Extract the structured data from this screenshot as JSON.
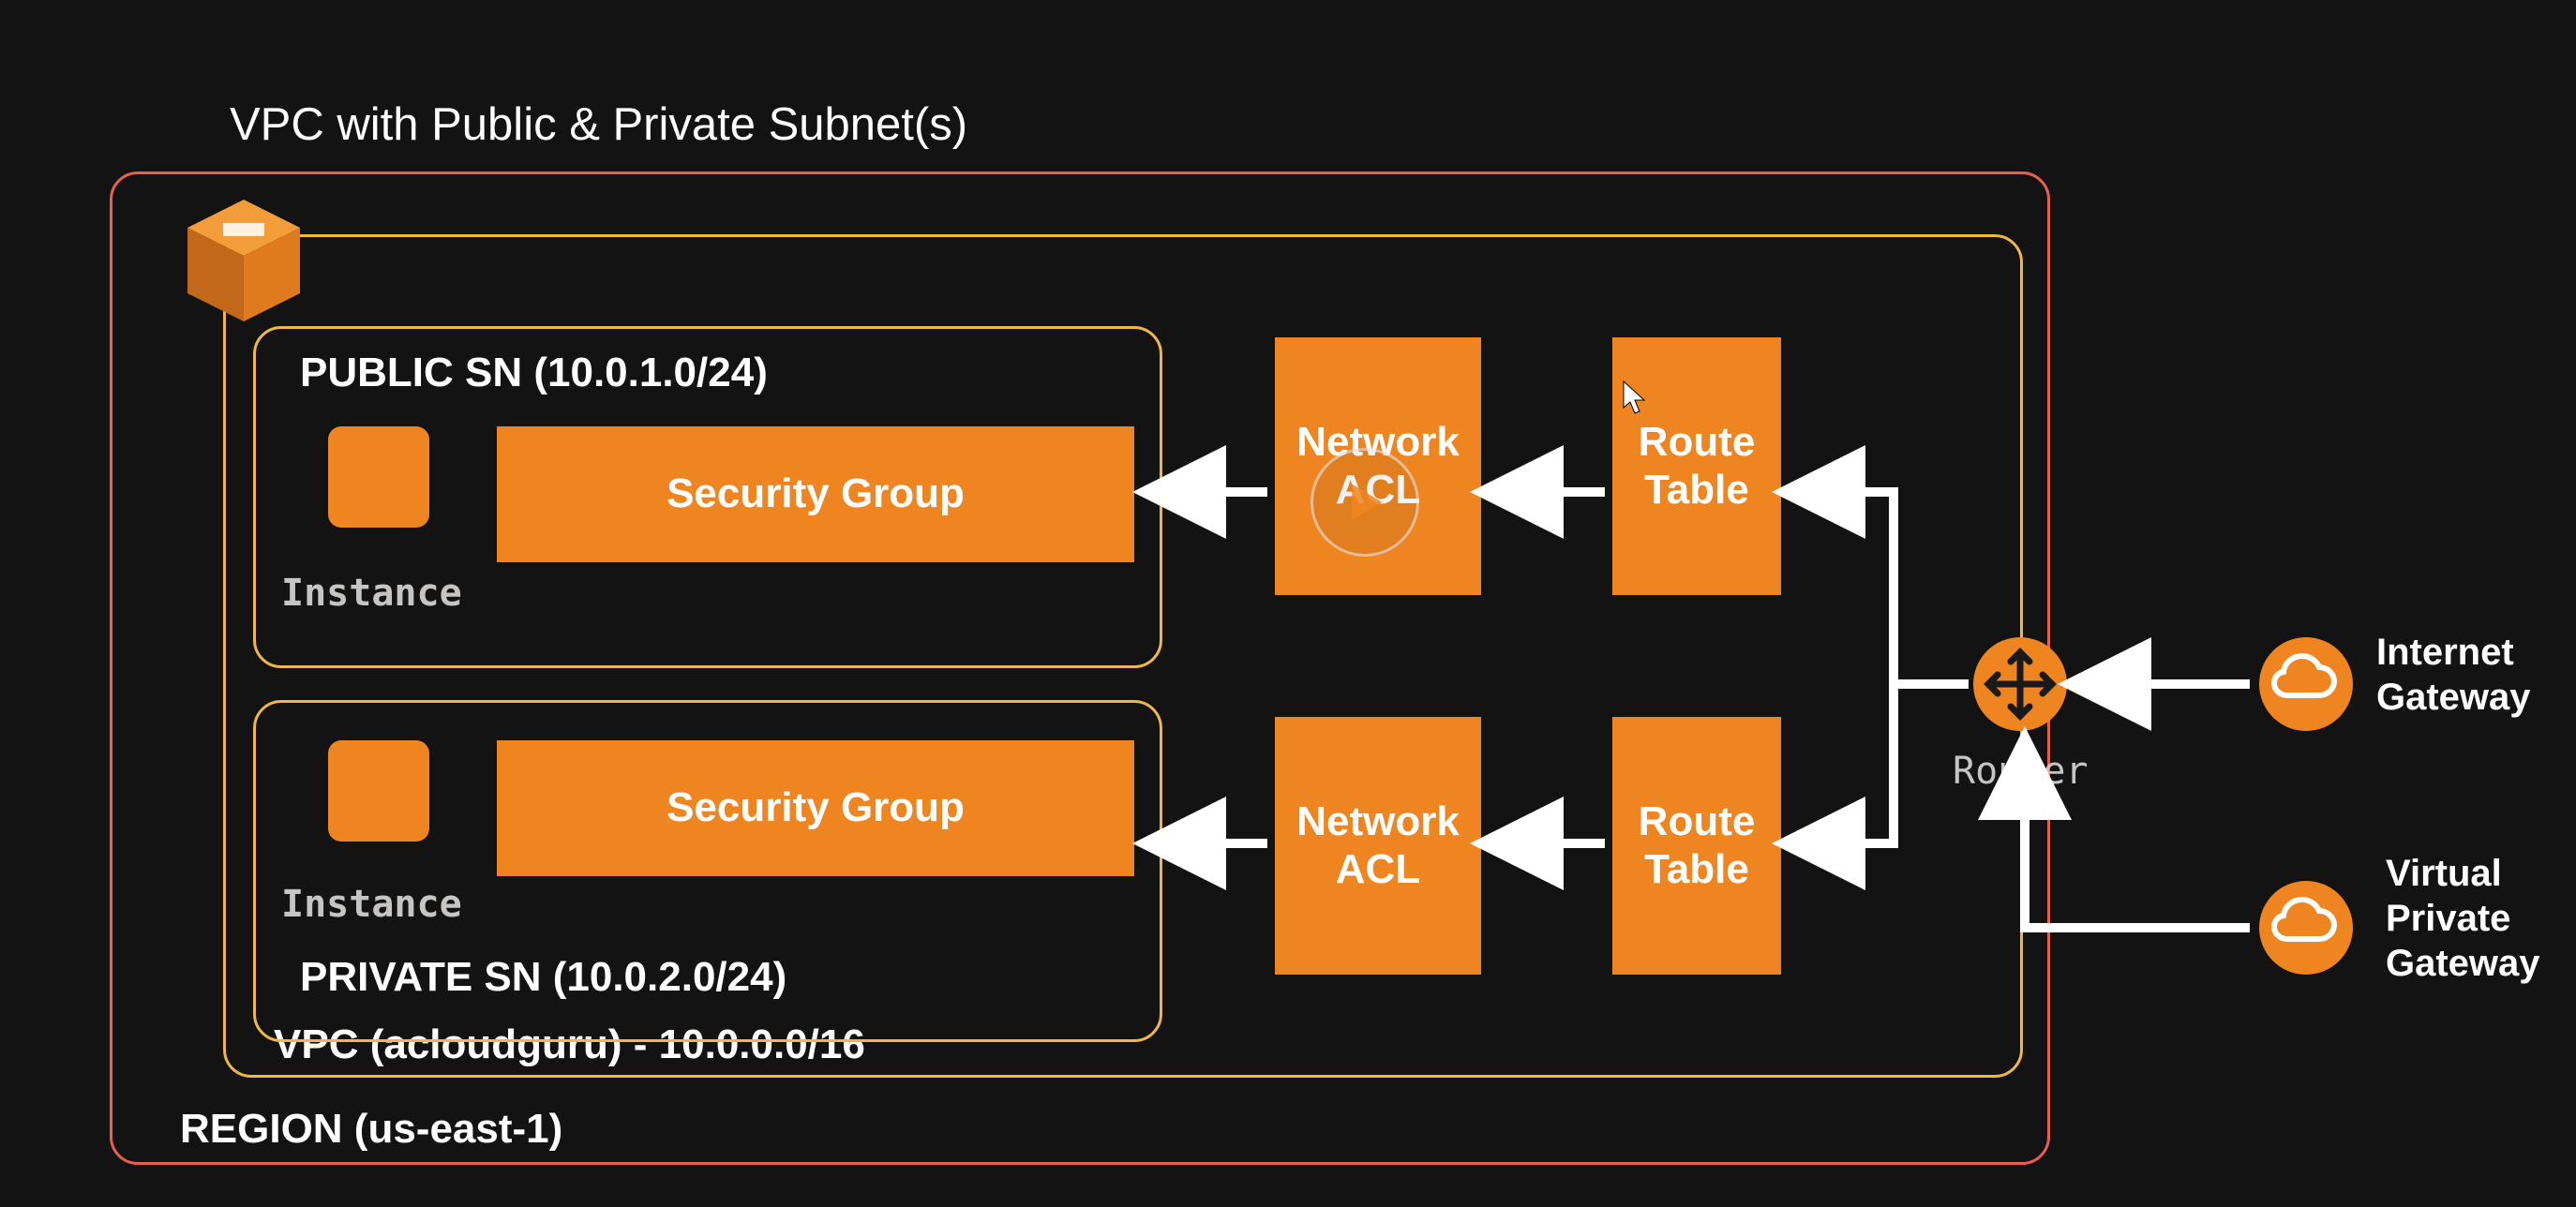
{
  "title": "VPC with Public & Private Subnet(s)",
  "region": {
    "label": "REGION (us-east-1)"
  },
  "vpc": {
    "label": "VPC (acloudguru) - 10.0.0.0/16"
  },
  "public_subnet": {
    "label": "PUBLIC SN (10.0.1.0/24)",
    "instance_label": "Instance",
    "sg_label": "Security Group"
  },
  "private_subnet": {
    "label": "PRIVATE SN (10.0.2.0/24)",
    "instance_label": "Instance",
    "sg_label": "Security Group"
  },
  "boxes": {
    "nacl_top": "Network\nACL",
    "nacl_bottom": "Network\nACL",
    "rt_top": "Route\nTable",
    "rt_bottom": "Route\nTable"
  },
  "router": {
    "label": "Router"
  },
  "gateways": {
    "internet": "Internet\nGateway",
    "vpn": "Virtual\nPrivate\nGateway"
  },
  "colors": {
    "orange": "#EE8521",
    "region_border": "#E75F51",
    "vpc_border": "#EEB64B",
    "bg": "#131313"
  }
}
